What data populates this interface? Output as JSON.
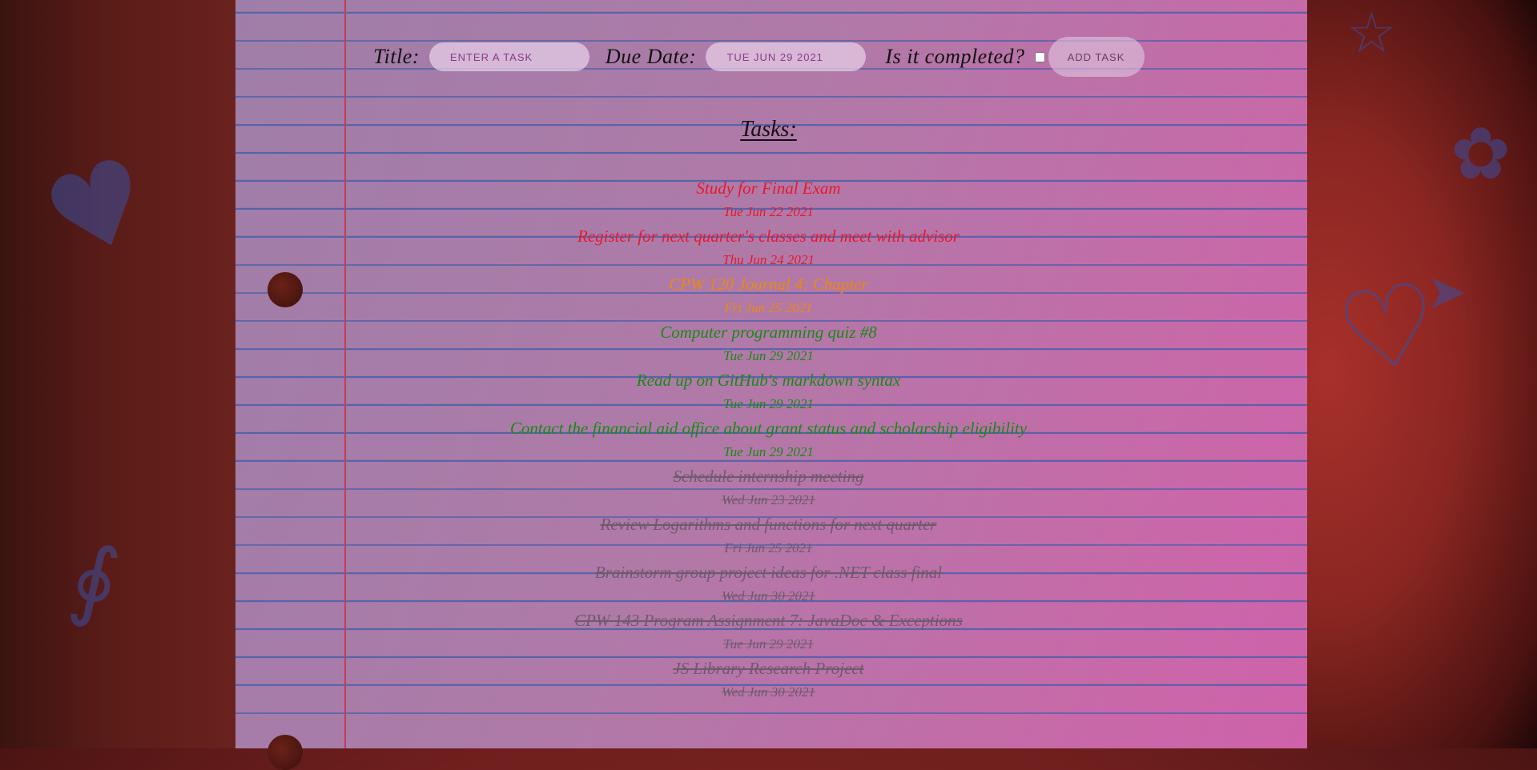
{
  "form": {
    "title_label": "Title:",
    "title_placeholder": "ENTER A TASK",
    "due_label": "Due Date:",
    "due_value": "TUE JUN 29 2021",
    "completed_label": "Is it completed?",
    "add_button": "ADD TASK"
  },
  "heading": "Tasks:",
  "tasks": [
    {
      "title": "Study for Final Exam",
      "date": "Tue Jun 22 2021",
      "color": "#e8182c",
      "done": false
    },
    {
      "title": "Register for next quarter's classes and meet with advisor",
      "date": "Thu Jun 24 2021",
      "color": "#e8182c",
      "done": false
    },
    {
      "title": "CPW 120 Journal 4: Chapter",
      "date": "Fri Jun 25 2021",
      "color": "#e88a10",
      "done": false
    },
    {
      "title": "Computer programming quiz #8",
      "date": "Tue Jun 29 2021",
      "color": "#178a17",
      "done": false
    },
    {
      "title": "Read up on GitHub's markdown syntax",
      "date": "Tue Jun 29 2021",
      "color": "#178a17",
      "done": false
    },
    {
      "title": "Contact the financial aid office about grant status and scholarship eligibility",
      "date": "Tue Jun 29 2021",
      "color": "#178a17",
      "done": false
    },
    {
      "title": "Schedule internship meeting",
      "date": "Wed Jun 23 2021",
      "color": "#6e5a6e",
      "done": true
    },
    {
      "title": "Review Logarithms and functions for next quarter",
      "date": "Fri Jun 25 2021",
      "color": "#6e5a6e",
      "done": true
    },
    {
      "title": "Brainstorm group project ideas for .NET class final",
      "date": "Wed Jun 30 2021",
      "color": "#6e5a6e",
      "done": true
    },
    {
      "title": "CPW 143 Program Assignment 7: JavaDoc & Exceptions",
      "date": "Tue Jun 29 2021",
      "color": "#6e5a6e",
      "done": true
    },
    {
      "title": "JS Library Research Project",
      "date": "Wed Jun 30 2021",
      "color": "#6e5a6e",
      "done": true
    }
  ]
}
